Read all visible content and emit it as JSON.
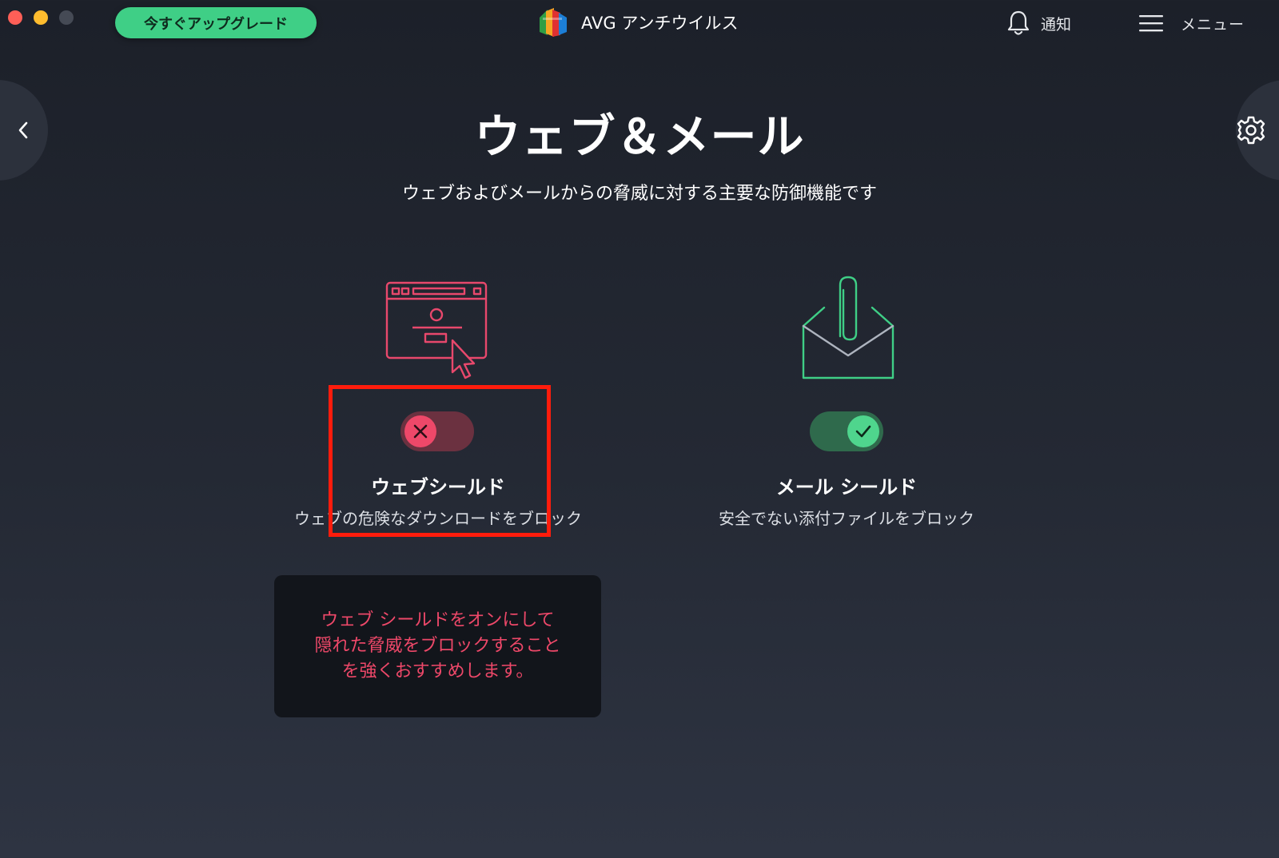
{
  "window": {
    "title": "AVG アンチウイルス"
  },
  "toolbar": {
    "upgrade_label": "今すぐアップグレード",
    "notifications_label": "通知",
    "menu_label": "メニュー"
  },
  "page": {
    "title": "ウェブ＆メール",
    "subtitle": "ウェブおよびメールからの脅威に対する主要な防御機能です"
  },
  "shields": {
    "web": {
      "name": "ウェブシールド",
      "description": "ウェブの危険なダウンロードをブロック",
      "enabled": false,
      "icon": "browser-cursor-icon",
      "warning": "ウェブ シールドをオンにして隠れた脅威をブロックすることを強くおすすめします。"
    },
    "mail": {
      "name": "メール シールド",
      "description": "安全でない添付ファイルをブロック",
      "enabled": true,
      "icon": "envelope-paperclip-icon"
    }
  },
  "colors": {
    "accent_green": "#3fcf86",
    "danger_pink": "#ee4869",
    "highlight_red": "#ff1c0c",
    "background": "#242934"
  }
}
